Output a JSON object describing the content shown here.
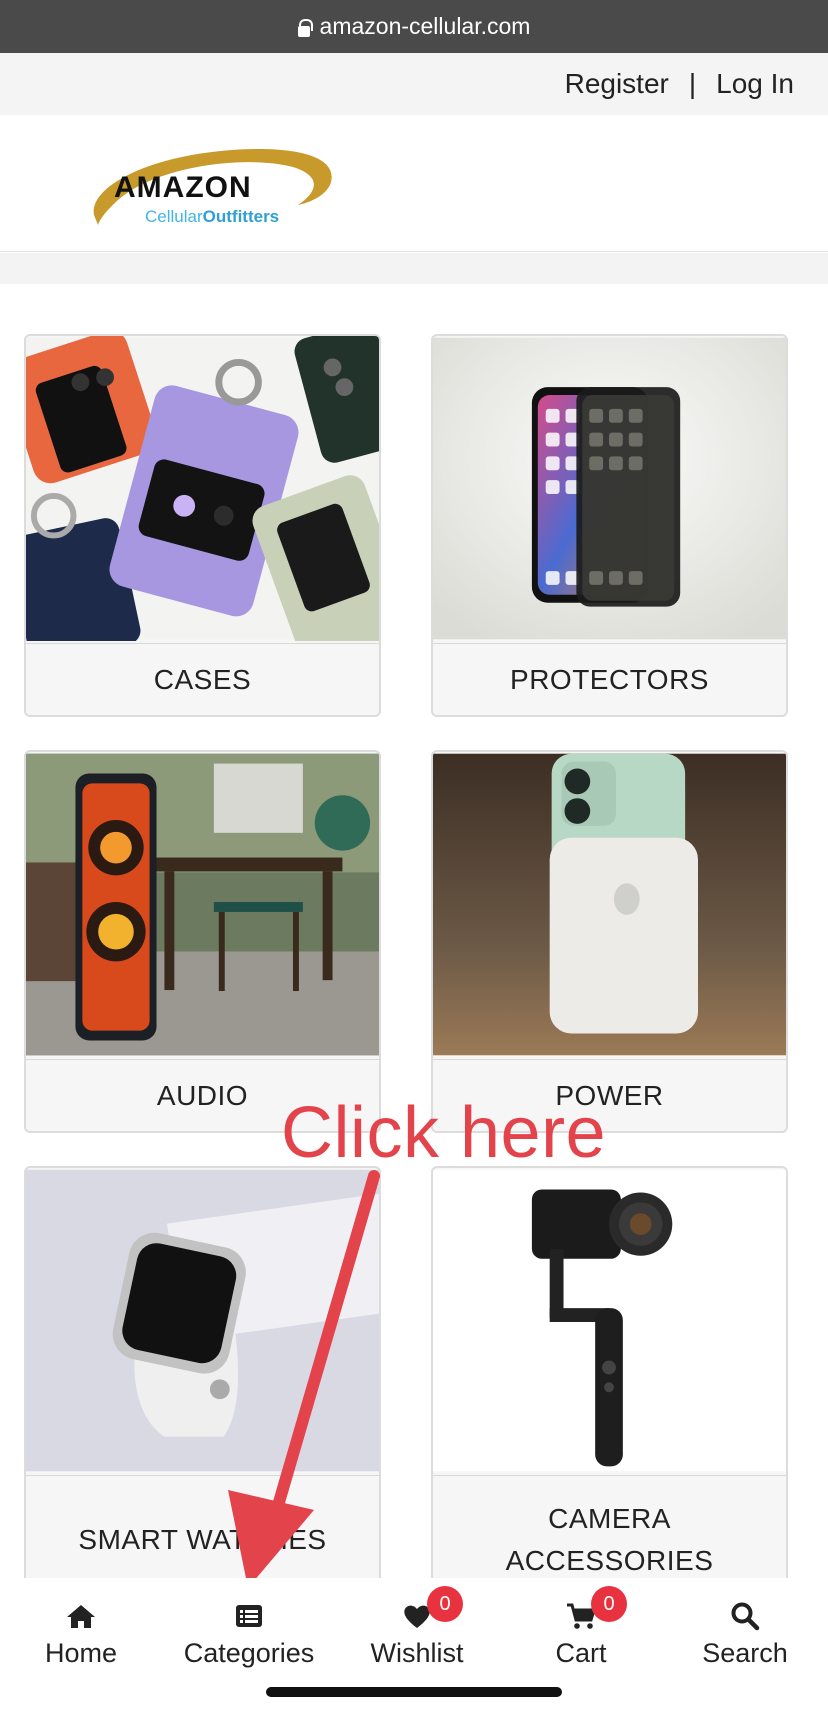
{
  "browser": {
    "url": "amazon-cellular.com"
  },
  "topbar": {
    "register": "Register",
    "separator": "|",
    "login": "Log In"
  },
  "logo": {
    "brand": "AMAZON",
    "sub_a": "Cellular",
    "sub_b": "Outfitters"
  },
  "categories": [
    {
      "label": "CASES",
      "image": "phone-cases"
    },
    {
      "label": "PROTECTORS",
      "image": "screen-protector"
    },
    {
      "label": "AUDIO",
      "image": "speaker"
    },
    {
      "label": "POWER",
      "image": "battery-pack"
    },
    {
      "label": "SMART WATCHES",
      "image": "smartwatch"
    },
    {
      "label": "CAMERA ACCESSORIES",
      "image": "gimbal"
    }
  ],
  "annotation": {
    "text": "Click here",
    "color": "#e3434a"
  },
  "bottom_nav": [
    {
      "label": "Home",
      "icon": "home-icon"
    },
    {
      "label": "Categories",
      "icon": "list-icon"
    },
    {
      "label": "Wishlist",
      "icon": "heart-icon",
      "badge": "0"
    },
    {
      "label": "Cart",
      "icon": "cart-icon",
      "badge": "0"
    },
    {
      "label": "Search",
      "icon": "search-icon"
    }
  ],
  "colors": {
    "badge": "#e8323f",
    "logo_ring": "#c79a2b",
    "logo_sub": "#3fb6e3"
  }
}
